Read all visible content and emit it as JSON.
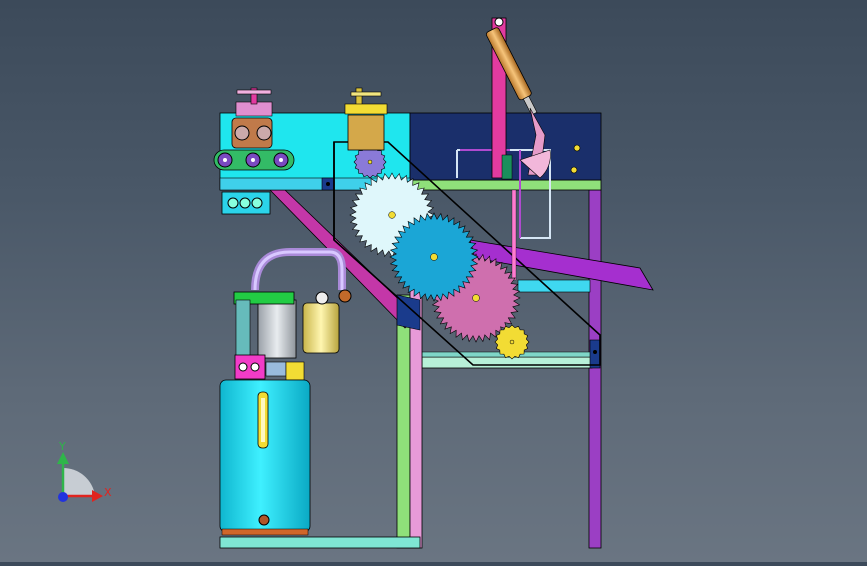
{
  "viewport": {
    "background_top": "#3c4a5a",
    "background_bottom": "#6a7582"
  },
  "triad": {
    "x_label": "X",
    "y_label": "Y",
    "x_color": "#e0241f",
    "y_color": "#2fb54a",
    "z_color": "#2233dd"
  },
  "colors": {
    "frame_purple": "#9b3fc4",
    "frame_magenta": "#cc2f9a",
    "frame_green": "#8fe07a",
    "pink_post": "#e23ba0",
    "cyan_box": "#1fe6ee",
    "navy_panel": "#1a2f6b",
    "gear_white": "#dff7fb",
    "gear_cyan": "#1ba6d6",
    "gear_pink": "#cf6fae",
    "gear_yellow": "#f2dc34",
    "gear_orange": "#e8581f",
    "tank_cyan": "#22d8f0",
    "cylinder_orange": "#e4a24a",
    "chute_purple": "#a52fcf"
  }
}
